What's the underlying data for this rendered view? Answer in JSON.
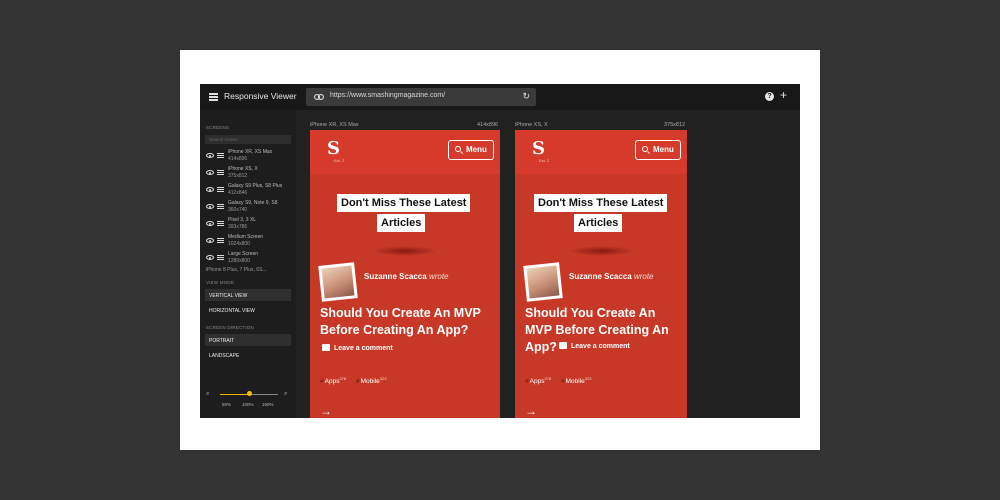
{
  "app": {
    "title": "Responsive Viewer"
  },
  "urlbar": {
    "url": "https://www.smashingmagazine.com/"
  },
  "sidebar": {
    "screens_heading": "SCREENS",
    "search_placeholder": "Search screen",
    "devices": [
      {
        "name": "iPhone XR, XS Max",
        "size": "414x896"
      },
      {
        "name": "iPhone XS, X",
        "size": "375x812"
      },
      {
        "name": "Galaxy S9 Plus, S8 Plus",
        "size": "412x846"
      },
      {
        "name": "Galaxy S9, Note 9, S8",
        "size": "360x740"
      },
      {
        "name": "Pixel 3, 3 XL",
        "size": "393x786"
      },
      {
        "name": "Medium Screen",
        "size": "1024x800"
      },
      {
        "name": "Large Screen",
        "size": "1280x800"
      }
    ],
    "more_device": "iPhone 8 Plus, 7 Plus, 6S...",
    "view_mode_heading": "VIEW MODE",
    "view_modes": [
      "VERTICAL VIEW",
      "HORIZONTAL VIEW"
    ],
    "selected_view_mode": "VERTICAL VIEW",
    "direction_heading": "SCREEN DIRECTION",
    "directions": [
      "PORTRAIT",
      "LANDSCAPE"
    ],
    "selected_direction": "PORTRAIT",
    "zoom": {
      "labels": [
        "50%",
        "100%",
        "150%"
      ],
      "value_fraction": 0.5
    }
  },
  "previews": [
    {
      "device": "iPhone XR, XS Max",
      "size": "414x896"
    },
    {
      "device": "iPhone XS, X",
      "size": "375x812"
    }
  ],
  "site": {
    "logo_letter": "S",
    "logo_sub": "Est. 2",
    "menu_label": "Menu",
    "heading_line1": "Don't Miss These Latest",
    "heading_line2": "Articles",
    "author": "Suzanne Scacca",
    "wrote": "wrote",
    "title_wide": [
      "Should You Create An MVP",
      "Before Creating An App?"
    ],
    "title_narrow": [
      "Should You Create An",
      "MVP Before Creating An",
      "App?"
    ],
    "comment": "Leave a comment",
    "tags": [
      {
        "name": "Apps",
        "count": "278"
      },
      {
        "name": "Mobile",
        "count": "323"
      }
    ],
    "arrow": "→"
  },
  "colors": {
    "accent": "#d33c2b",
    "zoom_knob": "#f0c000",
    "app_bg": "#212121"
  }
}
